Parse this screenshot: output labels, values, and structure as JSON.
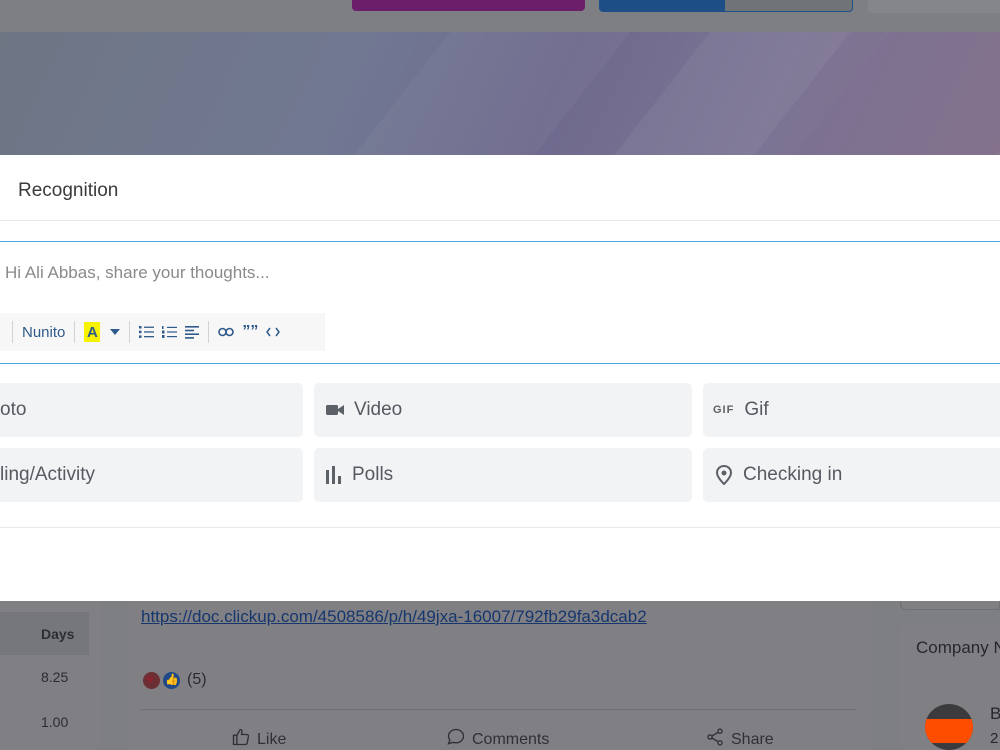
{
  "modal": {
    "title": "Recognition",
    "editor_placeholder": "Hi Ali Abbas, share your thoughts...",
    "toolbar": {
      "font_name": "Nunito",
      "highlight_letter": "A"
    },
    "options": [
      {
        "label": "oto",
        "icon": "photo-icon"
      },
      {
        "label": "Video",
        "icon": "video-camera-icon"
      },
      {
        "label": "Gif",
        "icon": "gif-icon",
        "icon_text": "GIF"
      },
      {
        "label": "ling/Activity",
        "icon": "feeling-icon"
      },
      {
        "label": "Polls",
        "icon": "poll-chart-icon"
      },
      {
        "label": "Checking in",
        "icon": "location-pin-icon"
      }
    ]
  },
  "background": {
    "days_table": {
      "header": "Days",
      "values": [
        "8.25",
        "1.00"
      ]
    },
    "post": {
      "link": "https://doc.clickup.com/4508586/p/h/49jxa-16007/792fb29fa3dcab2",
      "reaction_count": "(5)",
      "actions": {
        "like": "Like",
        "comments": "Comments",
        "share": "Share"
      }
    },
    "company_card": {
      "title": "Company N",
      "initial": "B",
      "sub": "2"
    }
  },
  "colors": {
    "editor_border": "#47a9e0",
    "highlight": "#f7f300",
    "toolbar_icon": "#2f5a8a",
    "option_bg": "#f2f3f5",
    "overlay_bg": "#7d7e82"
  }
}
